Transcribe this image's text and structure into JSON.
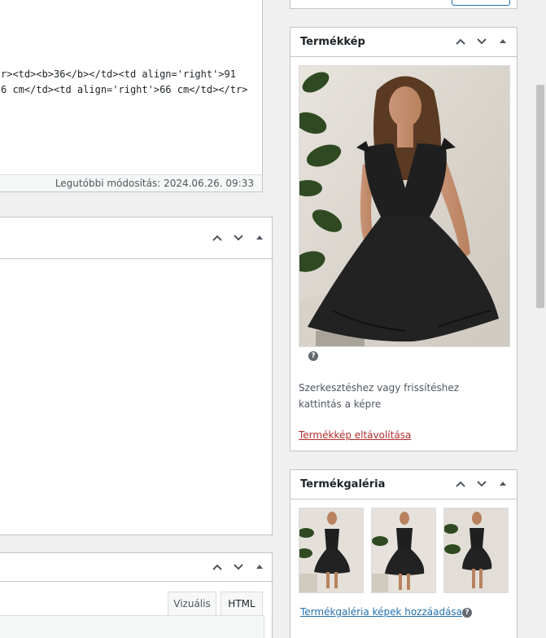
{
  "editor_top": {
    "code_lines": [
      "r><td><b>36</b></td><td align='right'>91",
      "6 cm</td><td align='right'>66 cm</td></tr>"
    ],
    "last_modified": "Legutóbbi módosítás: 2024.06.26. 09:33"
  },
  "product_image": {
    "title": "Termékkép",
    "hint": "Szerkesztéshez vagy frissítéshez kattintás a képre",
    "remove_link": "Termékkép eltávolítása",
    "help_glyph": "?"
  },
  "product_gallery": {
    "title": "Termékgaléria",
    "add_link": "Termékgaléria képek hozzáadása",
    "help_glyph": "?"
  },
  "editor_bottom": {
    "tabs": [
      "Vizuális",
      "HTML"
    ],
    "active_tab": "HTML"
  },
  "icons": {
    "up": "chevron-up-icon",
    "down": "chevron-down-icon",
    "toggle": "triangle-up-icon"
  },
  "colors": {
    "link": "#2271b1",
    "remove_link": "#b32d2e",
    "border": "#c3c4c7",
    "background": "#f0f0f1",
    "dress": "#1f1f1f"
  }
}
